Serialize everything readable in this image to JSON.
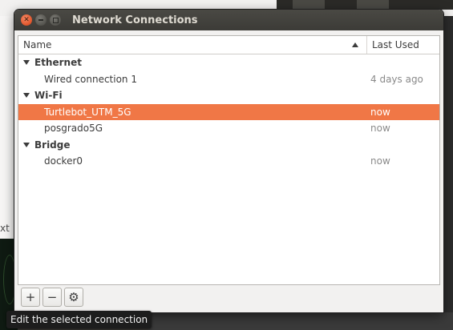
{
  "background": {
    "left_partial_text": "xt"
  },
  "window": {
    "title": "Network Connections"
  },
  "columns": {
    "name": "Name",
    "last_used": "Last Used"
  },
  "groups": [
    {
      "label": "Ethernet",
      "connections": [
        {
          "name": "Wired connection 1",
          "last_used": "4 days ago"
        }
      ]
    },
    {
      "label": "Wi-Fi",
      "connections": [
        {
          "name": "Turtlebot_UTM_5G",
          "last_used": "now",
          "selected": true
        },
        {
          "name": "posgrado5G",
          "last_used": "now"
        }
      ]
    },
    {
      "label": "Bridge",
      "connections": [
        {
          "name": "docker0",
          "last_used": "now"
        }
      ]
    }
  ],
  "toolbar": {
    "add_icon": "plus-icon",
    "add_label": "+",
    "remove_icon": "minus-icon",
    "remove_label": "−",
    "edit_icon": "gear-icon",
    "edit_label": "⚙"
  },
  "tooltip": {
    "text": "Edit the selected connection"
  },
  "colors": {
    "selection": "#f07746",
    "titlebar": "#3c3b37",
    "close_button": "#e0542a"
  }
}
